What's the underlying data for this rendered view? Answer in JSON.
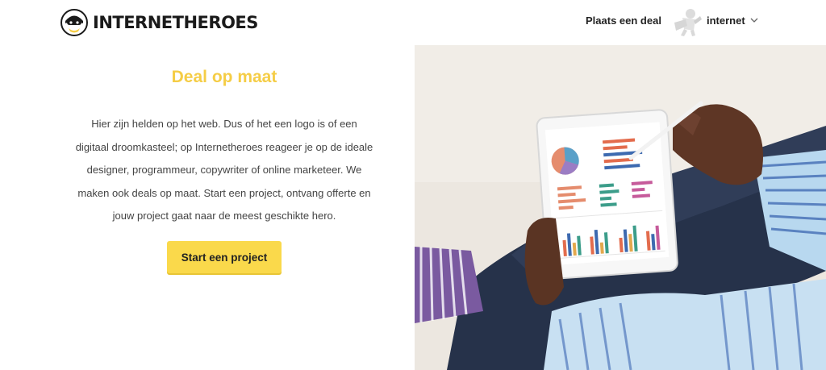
{
  "header": {
    "logo_text": "INTERNETHEROES",
    "nav_deal_label": "Plaats een deal",
    "user_name": "internet"
  },
  "hero": {
    "title": "Deal op maat",
    "paragraph_lines": [
      "Hier zijn helden op het web. Dus of het een logo is of een",
      "digitaal droomkasteel; op Internetheroes reageer je op de ideale",
      "designer, programmeur, copywriter of online marketeer. We",
      "maken ook deals op maat. Start een project, ontvang offerte en",
      "jouw project gaat naar de meest geschikte hero."
    ],
    "cta_label": "Start een project"
  },
  "colors": {
    "accent_yellow": "#fad94b",
    "title_yellow": "#f5cd46"
  },
  "icons": {
    "logo": "hero-mask-icon",
    "avatar": "superhero-avatar-icon",
    "dropdown": "chevron-down-icon"
  }
}
